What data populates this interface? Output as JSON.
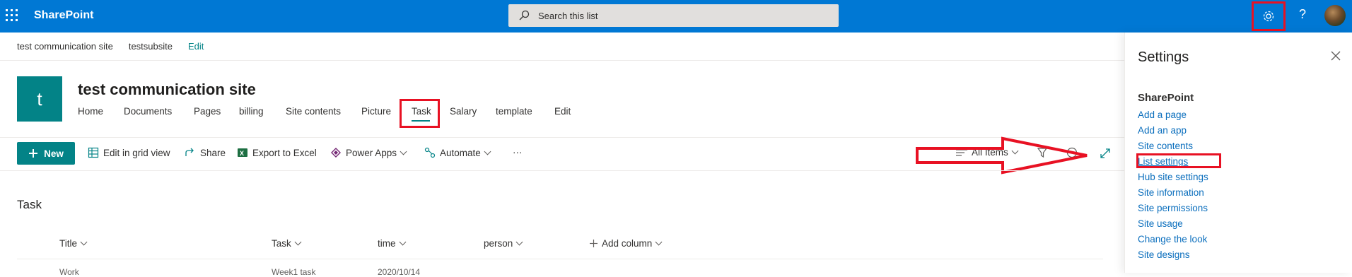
{
  "topbar": {
    "app_name": "SharePoint",
    "search_placeholder": "Search this list",
    "help_label": "?"
  },
  "breadcrumb": {
    "items": [
      "test communication site",
      "testsubsite"
    ],
    "edit_label": "Edit"
  },
  "site": {
    "logo_letter": "t",
    "title": "test communication site",
    "nav": [
      "Home",
      "Documents",
      "Pages",
      "billing",
      "Site contents",
      "Picture",
      "Task",
      "Salary",
      "template",
      "Edit"
    ],
    "active_nav": "Task"
  },
  "commands": {
    "new_label": "New",
    "edit_grid_label": "Edit in grid view",
    "share_label": "Share",
    "export_label": "Export to Excel",
    "power_apps_label": "Power Apps",
    "automate_label": "Automate",
    "more_label": "···",
    "view_label": "All Items"
  },
  "list": {
    "title": "Task",
    "columns": [
      "Title",
      "Task",
      "time",
      "person"
    ],
    "add_column_label": "Add column",
    "rows": [
      {
        "title": "Work",
        "task": "Week1 task",
        "time": "2020/10/14"
      }
    ]
  },
  "settings_panel": {
    "title": "Settings",
    "section": "SharePoint",
    "links": [
      "Add a page",
      "Add an app",
      "Site contents",
      "List settings",
      "Hub site settings",
      "Site information",
      "Site permissions",
      "Site usage",
      "Change the look",
      "Site designs"
    ],
    "highlighted_link": "List settings"
  },
  "colors": {
    "suite_bar": "#0078d4",
    "accent_teal": "#038387",
    "link_blue": "#0a6ebd",
    "annotation_red": "#e81123"
  },
  "icons": [
    "waffle-icon",
    "search-icon",
    "gear-icon",
    "help-icon",
    "avatar",
    "plus-icon",
    "grid-icon",
    "share-icon",
    "excel-icon",
    "power-apps-icon",
    "automate-icon",
    "view-lines-icon",
    "filter-icon",
    "info-icon",
    "expand-icon",
    "close-icon"
  ]
}
